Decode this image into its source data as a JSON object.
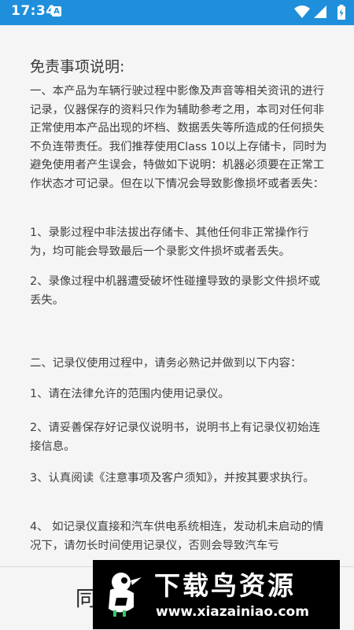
{
  "status_bar": {
    "time": "17:34",
    "notification_letter": "A",
    "background_color": "#1f8fdb"
  },
  "disclaimer": {
    "title": "免责事项说明:",
    "paragraphs": [
      "一、本产品为车辆行驶过程中影像及声音等相关资讯的进行记录，仪器保存的资料只作为辅助参考之用，本司对任何非正常使用本产品出现的坏档、数据丢失等所造成的任何损失不负连带责任。我们推荐使用Class 10以上存储卡，同时为避免使用者产生误会，特做如下说明：机器必须要在正常工作状态才可记录。但在以下情况会导致影像损坏或者丢失：",
      "1、录影过程中非法拔出存储卡、其他任何非正常操作行为，均可能会导致最后一个录影文件损坏或者丢失。",
      "2、录像过程中机器遭受破坏性碰撞导致的录影文件损坏或丢失。",
      "二、记录仪使用过程中，请务必熟记并做到以下内容：",
      "1、请在法律允许的范围内使用记录仪。",
      "2、请妥善保存好记录仪说明书，说明书上有记录仪初始连接信息。",
      "3、认真阅读《注意事项及客户须知》，并按其要求执行。",
      "4、 如记录仪直接和汽车供电系统相连，发动机未启动的情况下，请勿长时间使用记录仪，否则会导致汽车亏"
    ]
  },
  "bottom": {
    "agree_label": "同"
  },
  "watermark": {
    "title": "下载鸟资源",
    "url": "www.xiazainiao.com"
  }
}
